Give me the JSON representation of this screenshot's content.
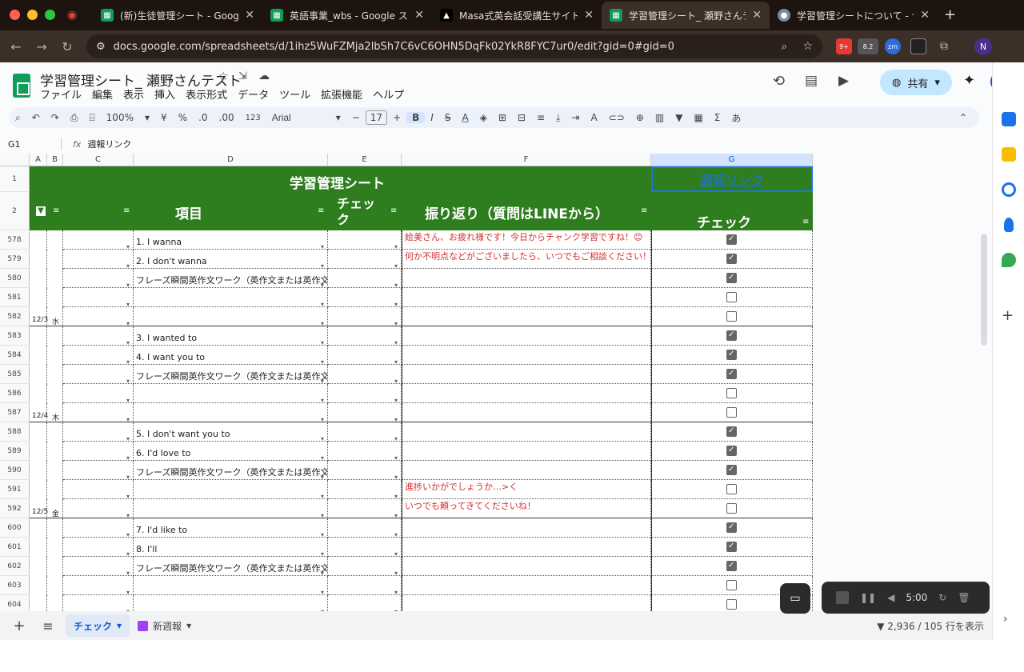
{
  "browser": {
    "tabs": [
      {
        "label": "(新)生徒管理シート - Google ス",
        "icon": "sheets-icon"
      },
      {
        "label": "英語事業_wbs - Google スプレ",
        "icon": "sheets-icon"
      },
      {
        "label": "Masa式英会話受講生サイト",
        "icon": "site-icon"
      },
      {
        "label": "学習管理シート_ 瀬野さんテスト",
        "icon": "sheets-icon",
        "active": true
      },
      {
        "label": "学習管理シートについて - 合同会",
        "icon": "doc-icon"
      }
    ],
    "url": "docs.google.com/spreadsheets/d/1ihz5WuFZMja2lbSh7C6vC6OHN5DqFk02YkR8FYC7ur0/edit?gid=0#gid=0",
    "ext_badges": [
      "9+",
      "8.2",
      "zm"
    ],
    "profile": "N"
  },
  "sheet": {
    "title": "学習管理シート_ 瀬野さんテスト",
    "menus": [
      "ファイル",
      "編集",
      "表示",
      "挿入",
      "表示形式",
      "データ",
      "ツール",
      "拡張機能",
      "ヘルプ"
    ],
    "share_label": "共有",
    "toolbar": {
      "zoom": "100%",
      "currency": "¥",
      "percent": "%",
      "dec_minus": ".0",
      "dec_plus": ".00",
      "format123": "123",
      "font": "Arial",
      "size": "17",
      "bold": "B",
      "italic": "I"
    },
    "cell_ref": "G1",
    "formula": "週報リンク",
    "col_headers": [
      "A",
      "B",
      "C",
      "D",
      "E",
      "F",
      "G"
    ],
    "header_title": "学習管理シート",
    "header_link": "週報リンク",
    "h_item": "項目",
    "h_check": "チェック",
    "h_review": "振り返り（質問はLINEから）",
    "h_check2": "チェック"
  },
  "rows": [
    {
      "n": "578",
      "d": "1. I wanna",
      "f": "絵美さん、お疲れ様です！今日からチャンク学習ですね！😊",
      "g": true
    },
    {
      "n": "579",
      "d": "2. I don't wanna",
      "f": "何か不明点などがございましたら、いつでもご相談ください！",
      "g": true
    },
    {
      "n": "580",
      "d": "フレーズ瞬間英作文ワーク（英作文または英作文/",
      "f": "",
      "g": true
    },
    {
      "n": "581",
      "d": "",
      "f": "",
      "g": false
    },
    {
      "n": "582",
      "d": "",
      "f": "",
      "g": false,
      "date": "12/3",
      "wd": "水"
    },
    {
      "n": "583",
      "d": "3. I wanted to",
      "f": "",
      "g": true
    },
    {
      "n": "584",
      "d": "4. I want you to",
      "f": "",
      "g": true
    },
    {
      "n": "585",
      "d": "フレーズ瞬間英作文ワーク（英作文または英作文/",
      "f": "",
      "g": true
    },
    {
      "n": "586",
      "d": "",
      "f": "",
      "g": false
    },
    {
      "n": "587",
      "d": "",
      "f": "",
      "g": false,
      "date": "12/4",
      "wd": "木"
    },
    {
      "n": "588",
      "d": "5. I don't want you to",
      "f": "",
      "g": true
    },
    {
      "n": "589",
      "d": "6. I'd love to",
      "f": "",
      "g": true
    },
    {
      "n": "590",
      "d": "フレーズ瞬間英作文ワーク（英作文または英作文/",
      "f": "",
      "g": true
    },
    {
      "n": "591",
      "d": "",
      "f": "進捗いかがでしょうか…>く",
      "g": false
    },
    {
      "n": "592",
      "d": "",
      "f": "いつでも頼ってきてくださいね！",
      "g": false,
      "date": "12/5",
      "wd": "金"
    },
    {
      "n": "600",
      "d": "7. I'd like to",
      "f": "",
      "g": true
    },
    {
      "n": "601",
      "d": "8. I'll",
      "f": "",
      "g": true
    },
    {
      "n": "602",
      "d": "フレーズ瞬間英作文ワーク（英作文または英作文/",
      "f": "",
      "g": true
    },
    {
      "n": "603",
      "d": "",
      "f": "",
      "g": false
    },
    {
      "n": "604",
      "d": "",
      "f": "",
      "g": false
    }
  ],
  "bottom": {
    "tab_active": "チェック",
    "tab2": "新週報",
    "status": "2,936 / 105 行を表示"
  },
  "recorder": {
    "time": "5:00"
  }
}
